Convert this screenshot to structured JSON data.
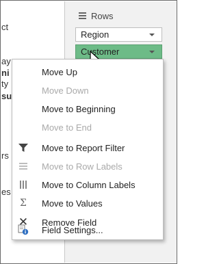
{
  "left_pane": {
    "fragments": [
      {
        "text": "ct",
        "bold": false
      },
      {
        "text": "ay",
        "bold": false
      },
      {
        "text": "ni",
        "bold": true
      },
      {
        "text": "ty",
        "bold": false
      },
      {
        "text": "su",
        "bold": true
      },
      {
        "text": "rs",
        "bold": false
      },
      {
        "text": "es",
        "bold": false
      }
    ]
  },
  "rows_area": {
    "title": "Rows",
    "fields": [
      {
        "label": "Region",
        "selected": false
      },
      {
        "label": "Customer",
        "selected": true
      }
    ],
    "selected_color": "#6dbb87"
  },
  "context_menu": {
    "items": [
      {
        "label": "Move Up",
        "enabled": true,
        "icon": "none"
      },
      {
        "label": "Move Down",
        "enabled": false,
        "icon": "none"
      },
      {
        "label": "Move to Beginning",
        "enabled": true,
        "icon": "none"
      },
      {
        "label": "Move to End",
        "enabled": false,
        "icon": "none"
      },
      {
        "label": "Move to Report Filter",
        "enabled": true,
        "icon": "filter-icon"
      },
      {
        "label": "Move to Row Labels",
        "enabled": false,
        "icon": "row-labels-icon"
      },
      {
        "label": "Move to Column Labels",
        "enabled": true,
        "icon": "column-labels-icon"
      },
      {
        "label": "Move to Values",
        "enabled": true,
        "icon": "sigma-icon"
      },
      {
        "label": "Remove Field",
        "enabled": true,
        "icon": "close-icon"
      },
      {
        "label": "Field Settings...",
        "enabled": true,
        "icon": "field-settings-icon"
      }
    ]
  }
}
